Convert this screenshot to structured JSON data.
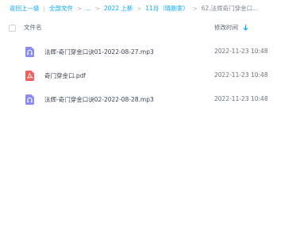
{
  "breadcrumb": {
    "back": "返回上一级",
    "all_files": "全部文件",
    "ellipsis": "...",
    "level1": "2022 上新",
    "level2": "11月（晓刚家）",
    "current": "62.法辉奇门穿金口..."
  },
  "table": {
    "col_name": "文件名",
    "col_time": "修改时间"
  },
  "files": [
    {
      "name": "法辉-奇门穿金口诀01-2022-08-27.mp3",
      "time": "2022-11-23 10:48",
      "type": "audio"
    },
    {
      "name": "奇门穿金口.pdf",
      "time": "2022-11-23 10:48",
      "type": "pdf"
    },
    {
      "name": "法辉-奇门穿金口诀02-2022-08-28.mp3",
      "time": "2022-11-23 10:48",
      "type": "audio"
    }
  ],
  "colors": {
    "link": "#06a7ff",
    "audio_icon": "#8c8cf5",
    "pdf_icon": "#f3605a"
  }
}
